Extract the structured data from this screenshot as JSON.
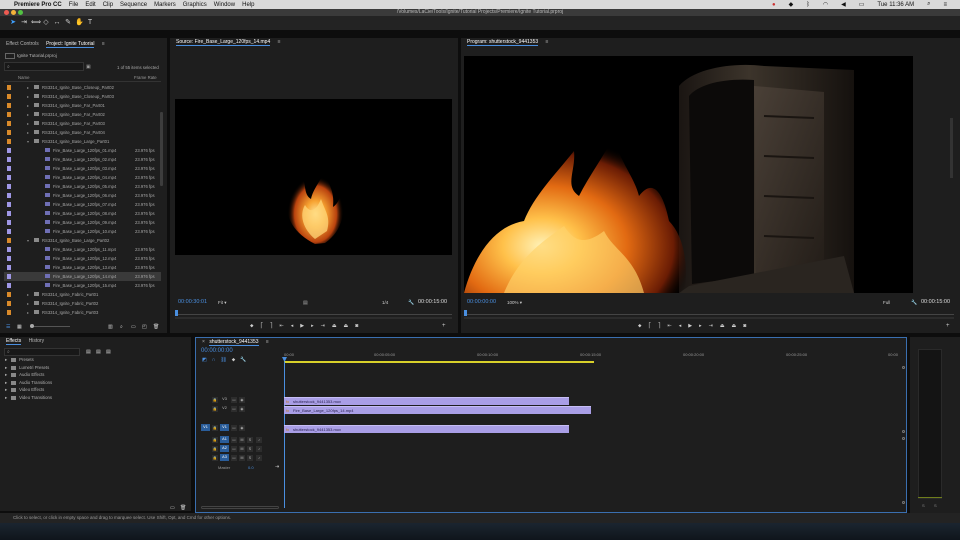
{
  "menubar": {
    "app_name": "Premiere Pro CC",
    "items": [
      "File",
      "Edit",
      "Clip",
      "Sequence",
      "Markers",
      "Graphics",
      "Window",
      "Help"
    ],
    "clock": "Tue 11:36 AM"
  },
  "window": {
    "path": "/Volumes/LaCie/Tools/Ignite/Tutorial Projects/Premiere/Ignite Tutorial.prproj"
  },
  "project_panel": {
    "tabs": [
      "Effect Controls",
      "Project: Ignite Tutorial"
    ],
    "project_file": "Ignite Tutorial.prproj",
    "items_selected": "1 of 55 items selected",
    "col_name": "Name",
    "col_frame_rate": "Frame Rate",
    "rows": [
      {
        "name": "RS3314_Ignite_Base_Closeup_Part02",
        "type": "bin",
        "indent": 0,
        "rate": "",
        "chip": "#d98a2a"
      },
      {
        "name": "RS3314_Ignite_Base_Closeup_Part03",
        "type": "bin",
        "indent": 0,
        "rate": "",
        "chip": "#d98a2a"
      },
      {
        "name": "RS3314_Ignite_Base_Far_Part01",
        "type": "bin",
        "indent": 0,
        "rate": "",
        "chip": "#d98a2a"
      },
      {
        "name": "RS3314_Ignite_Base_Far_Part02",
        "type": "bin",
        "indent": 0,
        "rate": "",
        "chip": "#d98a2a"
      },
      {
        "name": "RS3314_Ignite_Base_Far_Part03",
        "type": "bin",
        "indent": 0,
        "rate": "",
        "chip": "#d98a2a"
      },
      {
        "name": "RS3314_Ignite_Base_Far_Part04",
        "type": "bin",
        "indent": 0,
        "rate": "",
        "chip": "#d98a2a"
      },
      {
        "name": "RS3314_Ignite_Base_Large_Part01",
        "type": "bin-open",
        "indent": 0,
        "rate": "",
        "chip": "#d98a2a"
      },
      {
        "name": "Fire_Base_Large_120fps_01.mp4",
        "type": "clip",
        "indent": 1,
        "rate": "23.976 fps",
        "chip": "#9f97e6"
      },
      {
        "name": "Fire_Base_Large_120fps_02.mp4",
        "type": "clip",
        "indent": 1,
        "rate": "23.976 fps",
        "chip": "#9f97e6"
      },
      {
        "name": "Fire_Base_Large_120fps_03.mp4",
        "type": "clip",
        "indent": 1,
        "rate": "23.976 fps",
        "chip": "#9f97e6"
      },
      {
        "name": "Fire_Base_Large_120fps_04.mp4",
        "type": "clip",
        "indent": 1,
        "rate": "23.976 fps",
        "chip": "#9f97e6"
      },
      {
        "name": "Fire_Base_Large_120fps_05.mp4",
        "type": "clip",
        "indent": 1,
        "rate": "23.976 fps",
        "chip": "#9f97e6"
      },
      {
        "name": "Fire_Base_Large_120fps_06.mp4",
        "type": "clip",
        "indent": 1,
        "rate": "23.976 fps",
        "chip": "#9f97e6"
      },
      {
        "name": "Fire_Base_Large_120fps_07.mp4",
        "type": "clip",
        "indent": 1,
        "rate": "23.976 fps",
        "chip": "#9f97e6"
      },
      {
        "name": "Fire_Base_Large_120fps_08.mp4",
        "type": "clip",
        "indent": 1,
        "rate": "23.976 fps",
        "chip": "#9f97e6"
      },
      {
        "name": "Fire_Base_Large_120fps_09.mp4",
        "type": "clip",
        "indent": 1,
        "rate": "23.976 fps",
        "chip": "#9f97e6"
      },
      {
        "name": "Fire_Base_Large_120fps_10.mp4",
        "type": "clip",
        "indent": 1,
        "rate": "23.976 fps",
        "chip": "#9f97e6"
      },
      {
        "name": "RS3314_Ignite_Base_Large_Part02",
        "type": "bin-open",
        "indent": 0,
        "rate": "",
        "chip": "#d98a2a"
      },
      {
        "name": "Fire_Base_Large_120fps_11.mp4",
        "type": "clip",
        "indent": 1,
        "rate": "23.976 fps",
        "chip": "#9f97e6"
      },
      {
        "name": "Fire_Base_Large_120fps_12.mp4",
        "type": "clip",
        "indent": 1,
        "rate": "23.976 fps",
        "chip": "#9f97e6"
      },
      {
        "name": "Fire_Base_Large_120fps_13.mp4",
        "type": "clip",
        "indent": 1,
        "rate": "23.976 fps",
        "chip": "#9f97e6"
      },
      {
        "name": "Fire_Base_Large_120fps_14.mp4",
        "type": "clip",
        "indent": 1,
        "rate": "23.976 fps",
        "chip": "#9f97e6",
        "selected": true
      },
      {
        "name": "Fire_Base_Large_120fps_15.mp4",
        "type": "clip",
        "indent": 1,
        "rate": "23.976 fps",
        "chip": "#9f97e6"
      },
      {
        "name": "RS3314_Ignite_Fabric_Part01",
        "type": "bin",
        "indent": 0,
        "rate": "",
        "chip": "#d98a2a"
      },
      {
        "name": "RS3314_Ignite_Fabric_Part02",
        "type": "bin",
        "indent": 0,
        "rate": "",
        "chip": "#d98a2a"
      },
      {
        "name": "RS3314_Ignite_Fabric_Part03",
        "type": "bin",
        "indent": 0,
        "rate": "",
        "chip": "#d98a2a"
      }
    ]
  },
  "source_monitor": {
    "title": "Source: Fire_Base_Large_120fps_14.mp4",
    "timecode": "00:00:30:01",
    "fit": "Fit",
    "resolution": "1/4",
    "duration": "00:00:15:00"
  },
  "program_monitor": {
    "title": "Program: shutterstock_9441353",
    "timecode": "00:00:00:00",
    "zoom": "100%",
    "resolution": "Full",
    "duration": "00:00:15:00"
  },
  "effects_panel": {
    "tabs": [
      "Effects",
      "History"
    ],
    "items": [
      "Presets",
      "Lumetri Presets",
      "Audio Effects",
      "Audio Transitions",
      "Video Effects",
      "Video Transitions"
    ]
  },
  "timeline": {
    "sequence_tab": "shutterstock_9441353",
    "timecode": "00:00:00:00",
    "ruler": [
      "00:00",
      "00:00:05:00",
      "00:00:10:00",
      "00:00:15:00",
      "00:00:20:00",
      "00:00:25:00",
      "00:00"
    ],
    "video_tracks": [
      "V3",
      "V2",
      "V1"
    ],
    "audio_tracks": [
      "A1",
      "A2",
      "A3"
    ],
    "source_patch_v": "V1",
    "master_label": "Master",
    "master_value": "0.0",
    "clips": [
      {
        "name": "shutterstock_9441353.mov",
        "track": "V3"
      },
      {
        "name": "Fire_Base_Large_120fps_14.mp4",
        "track": "V2"
      },
      {
        "name": "shutterstock_9441353.mov",
        "track": "V1"
      }
    ]
  },
  "status_bar": "Click to select, or click in empty space and drag to marquee select. Use Shift, Opt, and Cmd for other options."
}
